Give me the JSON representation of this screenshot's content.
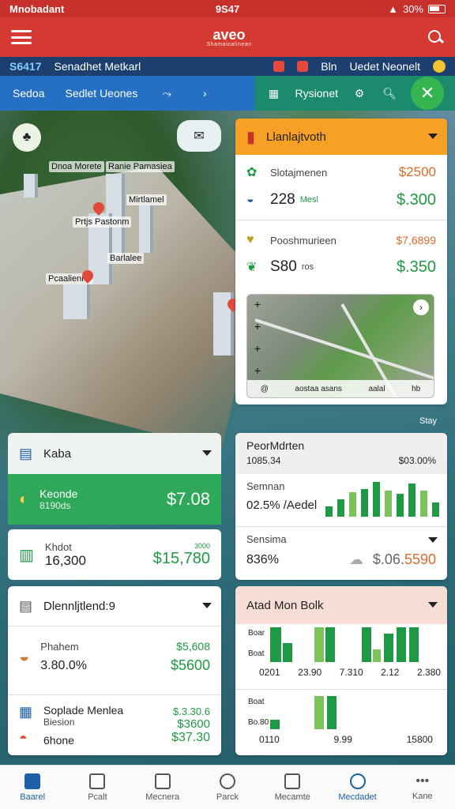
{
  "status": {
    "carrier": "Mnobadant",
    "time": "9S47",
    "battery": "30%"
  },
  "appbar": {
    "logo_main": "aveo",
    "logo_sub": "Shamaioalinean"
  },
  "ticker": {
    "code": "S6417",
    "name": "Senadhet Metkarl",
    "item": "Bln",
    "right": "Uedet Neonelt"
  },
  "toolbar": {
    "left_a": "Sedoa",
    "left_b": "Sedlet Ueones",
    "right_label": "Rysionet"
  },
  "map_labels": [
    "Dnoa Morete",
    "Ranie Pamasiea",
    "Mirtlamel",
    "Prtjs Pastonm",
    "Barlalee",
    "Pcaalienne",
    "Stay"
  ],
  "card_top": {
    "title": "Llanlajtvoth",
    "row1_label": "Slotajmenen",
    "row1_orange": "$2500",
    "row1_value": "228",
    "row1_tag": "Mesl",
    "row1_price": "$.300",
    "row2_label": "Pooshmurieen",
    "row2_orange": "$7,6899",
    "row2_value": "S80",
    "row2_tag": "ros",
    "row2_price": "$.350",
    "minimap_bottom": [
      "@",
      "aostaa asans",
      "aalal",
      "hb"
    ]
  },
  "card_kaba": {
    "title": "Kaba",
    "highlight_label": "Keonde",
    "highlight_sub": "8190ds",
    "highlight_price": "$7.08",
    "row_label": "Khdot",
    "row_value": "16,300",
    "row_price": "$15,780",
    "row_hint": "3000"
  },
  "card_stats": {
    "title": "PeorMdrten",
    "subtitle": "1085.34",
    "subtitle_right": "$03.00%",
    "row1_label": "Semnan",
    "row1_value": "02.5% /Aedel",
    "row2_label": "Sensima",
    "row2_value": "836%",
    "row2_price_a": "$.06.",
    "row2_price_b": "5590"
  },
  "card_diner": {
    "title": "Dlennljtlend:9",
    "row1_label": "Phahem",
    "row1_value": "3.80.0%",
    "row1_price_a": "$5,608",
    "row1_price_b": "$5600",
    "row2_label": "Soplade Menlea",
    "row2_sub": "Biesion",
    "row2_value": "6hone",
    "row2_price_a": "$.3.30.6",
    "row2_price_b": "$3600",
    "row2_price_c": "$37.30"
  },
  "card_bars": {
    "title": "Atad Mon Bolk",
    "row1_labels": [
      "Boar",
      "Boat"
    ],
    "row1_ticks": [
      "0201",
      "23.90",
      "7.310",
      "2.12",
      "2.380"
    ],
    "row2_labels": [
      "Boat",
      "Bo.80"
    ],
    "row2_ticks": [
      "0110",
      "9.99",
      "15800"
    ]
  },
  "chart_stats_bars": [
    12,
    20,
    28,
    32,
    40,
    30,
    26,
    38,
    30,
    16
  ],
  "bottomnav": [
    "Baarel",
    "Pcalt",
    "Mecnera",
    "Parck",
    "Mecamte",
    "Mecdadet",
    "Kane"
  ],
  "colors": {
    "appbar": "#d43a32",
    "ticker": "#1d3f70",
    "toolbar_left": "#2570c2",
    "toolbar_right": "#1b8a6d",
    "accent_green": "#1e9a45",
    "accent_orange": "#e06a2a"
  }
}
